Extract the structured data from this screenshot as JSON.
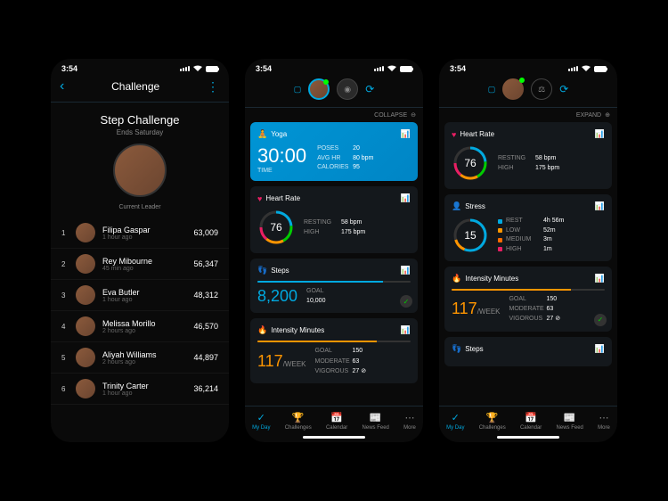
{
  "status": {
    "time": "3:54"
  },
  "screen1": {
    "title": "Challenge",
    "challenge_name": "Step Challenge",
    "ends": "Ends Saturday",
    "leader_label": "Current Leader",
    "rows": [
      {
        "rank": "1",
        "name": "Filipa Gaspar",
        "ago": "1 hour ago",
        "score": "63,009"
      },
      {
        "rank": "2",
        "name": "Rey Mibourne",
        "ago": "45 min ago",
        "score": "56,347"
      },
      {
        "rank": "3",
        "name": "Eva Butler",
        "ago": "1 hour ago",
        "score": "48,312"
      },
      {
        "rank": "4",
        "name": "Melissa Morillo",
        "ago": "2 hours ago",
        "score": "46,570"
      },
      {
        "rank": "5",
        "name": "Aliyah Williams",
        "ago": "2 hours ago",
        "score": "44,897"
      },
      {
        "rank": "6",
        "name": "Trinity Carter",
        "ago": "1 hour ago",
        "score": "36,214"
      }
    ]
  },
  "collapse": "COLLAPSE",
  "expand": "EXPAND",
  "yoga": {
    "title": "Yoga",
    "time": "30:00",
    "time_label": "TIME",
    "poses_l": "POSES",
    "poses": "20",
    "avghr_l": "AVG HR",
    "avghr": "80 bpm",
    "cal_l": "CALORIES",
    "cal": "95"
  },
  "hr": {
    "title": "Heart Rate",
    "value": "76",
    "resting_l": "RESTING",
    "resting": "58 bpm",
    "high_l": "HIGH",
    "high": "175 bpm"
  },
  "steps": {
    "title": "Steps",
    "value": "8,200",
    "goal_l": "GOAL",
    "goal": "10,000"
  },
  "intensity": {
    "title": "Intensity Minutes",
    "value": "117",
    "unit": "/WEEK",
    "goal_l": "GOAL",
    "goal": "150",
    "mod_l": "MODERATE",
    "mod": "63",
    "vig_l": "VIGOROUS",
    "vig": "27"
  },
  "stress": {
    "title": "Stress",
    "value": "15",
    "rest_l": "REST",
    "rest": "4h 56m",
    "low_l": "LOW",
    "low": "52m",
    "med_l": "MEDIUM",
    "med": "3m",
    "high_l": "HIGH",
    "high": "1m"
  },
  "nav": {
    "myday": "My Day",
    "challenges": "Challenges",
    "calendar": "Calendar",
    "newsfeed": "News Feed",
    "more": "More"
  }
}
